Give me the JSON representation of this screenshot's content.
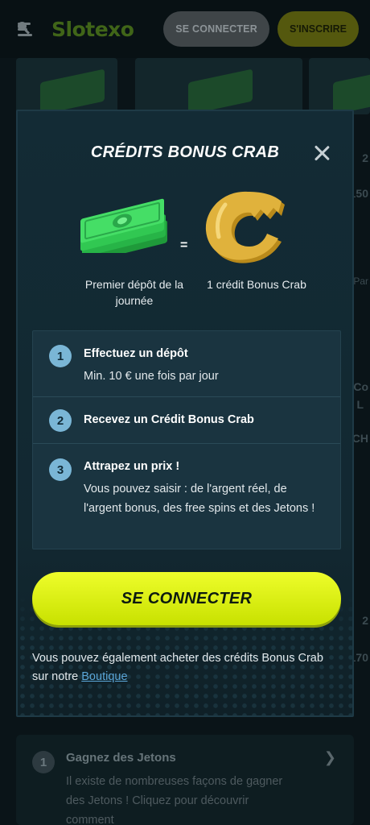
{
  "header": {
    "logo": "Slotexo",
    "connect_label": "SE CONNECTER",
    "signup_label": "S'INSCRIRE"
  },
  "background": {
    "side_texts": [
      "2",
      "150",
      "Par",
      "Co",
      "L",
      "CH",
      "2",
      "170"
    ],
    "card": {
      "number": "1",
      "title": "Gagnez des Jetons",
      "description": "Il existe de nombreuses façons de gagner des Jetons ! Cliquez pour découvrir comment"
    }
  },
  "modal": {
    "title": "CRÉDITS BONUS CRAB",
    "equals": "=",
    "left_caption": "Premier dépôt de la journée",
    "right_caption": "1 crédit Bonus Crab",
    "steps": [
      {
        "number": "1",
        "title": "Effectuez un dépôt",
        "description": "Min. 10 € une fois par jour"
      },
      {
        "number": "2",
        "title": "Recevez un Crédit Bonus Crab",
        "description": ""
      },
      {
        "number": "3",
        "title": "Attrapez un prix !",
        "description": "Vous pouvez saisir : de l'argent réel, de l'argent bonus, des free spins et des Jetons !"
      }
    ],
    "cta_label": "SE CONNECTER",
    "footnote": "Vous pouvez également acheter des crédits Bonus Crab sur notre",
    "footnote_link": "Boutique"
  },
  "colors": {
    "accent": "#dff10f",
    "step_circle": "#7ab6d6",
    "link": "#5ba6d8",
    "modal_bg": "#132b35"
  }
}
